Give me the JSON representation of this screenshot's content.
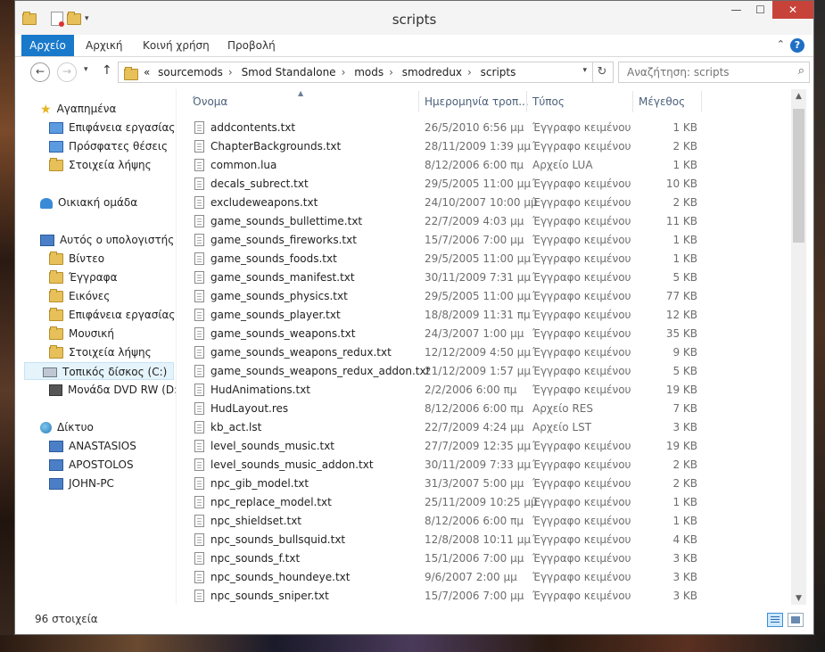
{
  "window": {
    "title": "scripts"
  },
  "window_buttons": {
    "minimize": "—",
    "maximize": "☐",
    "close": "✕"
  },
  "ribbon": {
    "tabs": [
      "Αρχείο",
      "Αρχική",
      "Κοινή χρήση",
      "Προβολή"
    ],
    "help": "?",
    "collapse": "⌃"
  },
  "nav": {
    "back": "←",
    "forward": "→",
    "recent": "▾",
    "up": "↑"
  },
  "address": {
    "overflow": "«",
    "crumbs": [
      "sourcemods",
      "Smod Standalone",
      "mods",
      "smodredux",
      "scripts"
    ],
    "dropdown": "▾",
    "refresh": "↻"
  },
  "search": {
    "placeholder": "Αναζήτηση: scripts",
    "icon": "⌕"
  },
  "sidebar": {
    "favorites": {
      "label": "Αγαπημένα",
      "items": [
        "Επιφάνεια εργασίας",
        "Πρόσφατες θέσεις",
        "Στοιχεία λήψης"
      ]
    },
    "homegroup": {
      "label": "Οικιακή ομάδα"
    },
    "computer": {
      "label": "Αυτός ο υπολογιστής",
      "items": [
        "Βίντεο",
        "Έγγραφα",
        "Εικόνες",
        "Επιφάνεια εργασίας",
        "Μουσική",
        "Στοιχεία λήψης",
        "Τοπικός δίσκος (C:)",
        "Μονάδα DVD RW (D:)"
      ]
    },
    "network": {
      "label": "Δίκτυο",
      "items": [
        "ANASTASIOS",
        "APOSTOLOS",
        "JOHN-PC"
      ]
    }
  },
  "columns": {
    "name": "Όνομα",
    "date": "Ημερομηνία τροπ...",
    "type": "Τύπος",
    "size": "Μέγεθος",
    "sort": "▲"
  },
  "files": [
    {
      "name": "addcontents.txt",
      "date": "26/5/2010 6:56 μμ",
      "type": "Έγγραφο κειμένου",
      "size": "1 KB"
    },
    {
      "name": "ChapterBackgrounds.txt",
      "date": "28/11/2009 1:39 μμ",
      "type": "Έγγραφο κειμένου",
      "size": "2 KB"
    },
    {
      "name": "common.lua",
      "date": "8/12/2006 6:00 πμ",
      "type": "Αρχείο LUA",
      "size": "1 KB"
    },
    {
      "name": "decals_subrect.txt",
      "date": "29/5/2005 11:00 μμ",
      "type": "Έγγραφο κειμένου",
      "size": "10 KB"
    },
    {
      "name": "excludeweapons.txt",
      "date": "24/10/2007 10:00 μμ",
      "type": "Έγγραφο κειμένου",
      "size": "2 KB"
    },
    {
      "name": "game_sounds_bullettime.txt",
      "date": "22/7/2009 4:03 μμ",
      "type": "Έγγραφο κειμένου",
      "size": "11 KB"
    },
    {
      "name": "game_sounds_fireworks.txt",
      "date": "15/7/2006 7:00 μμ",
      "type": "Έγγραφο κειμένου",
      "size": "1 KB"
    },
    {
      "name": "game_sounds_foods.txt",
      "date": "29/5/2005 11:00 μμ",
      "type": "Έγγραφο κειμένου",
      "size": "1 KB"
    },
    {
      "name": "game_sounds_manifest.txt",
      "date": "30/11/2009 7:31 μμ",
      "type": "Έγγραφο κειμένου",
      "size": "5 KB"
    },
    {
      "name": "game_sounds_physics.txt",
      "date": "29/5/2005 11:00 μμ",
      "type": "Έγγραφο κειμένου",
      "size": "77 KB"
    },
    {
      "name": "game_sounds_player.txt",
      "date": "18/8/2009 11:31 πμ",
      "type": "Έγγραφο κειμένου",
      "size": "12 KB"
    },
    {
      "name": "game_sounds_weapons.txt",
      "date": "24/3/2007 1:00 μμ",
      "type": "Έγγραφο κειμένου",
      "size": "35 KB"
    },
    {
      "name": "game_sounds_weapons_redux.txt",
      "date": "12/12/2009 4:50 μμ",
      "type": "Έγγραφο κειμένου",
      "size": "9 KB"
    },
    {
      "name": "game_sounds_weapons_redux_addon.txt",
      "date": "21/12/2009 1:57 μμ",
      "type": "Έγγραφο κειμένου",
      "size": "5 KB"
    },
    {
      "name": "HudAnimations.txt",
      "date": "2/2/2006 6:00 πμ",
      "type": "Έγγραφο κειμένου",
      "size": "19 KB"
    },
    {
      "name": "HudLayout.res",
      "date": "8/12/2006 6:00 πμ",
      "type": "Αρχείο RES",
      "size": "7 KB"
    },
    {
      "name": "kb_act.lst",
      "date": "22/7/2009 4:24 μμ",
      "type": "Αρχείο LST",
      "size": "3 KB"
    },
    {
      "name": "level_sounds_music.txt",
      "date": "27/7/2009 12:35 μμ",
      "type": "Έγγραφο κειμένου",
      "size": "19 KB"
    },
    {
      "name": "level_sounds_music_addon.txt",
      "date": "30/11/2009 7:33 μμ",
      "type": "Έγγραφο κειμένου",
      "size": "2 KB"
    },
    {
      "name": "npc_gib_model.txt",
      "date": "31/3/2007 5:00 μμ",
      "type": "Έγγραφο κειμένου",
      "size": "2 KB"
    },
    {
      "name": "npc_replace_model.txt",
      "date": "25/11/2009 10:25 μμ",
      "type": "Έγγραφο κειμένου",
      "size": "1 KB"
    },
    {
      "name": "npc_shieldset.txt",
      "date": "8/12/2006 6:00 πμ",
      "type": "Έγγραφο κειμένου",
      "size": "1 KB"
    },
    {
      "name": "npc_sounds_bullsquid.txt",
      "date": "12/8/2008 10:11 μμ",
      "type": "Έγγραφο κειμένου",
      "size": "4 KB"
    },
    {
      "name": "npc_sounds_f.txt",
      "date": "15/1/2006 7:00 μμ",
      "type": "Έγγραφο κειμένου",
      "size": "3 KB"
    },
    {
      "name": "npc_sounds_houndeye.txt",
      "date": "9/6/2007 2:00 μμ",
      "type": "Έγγραφο κειμένου",
      "size": "3 KB"
    },
    {
      "name": "npc_sounds_sniper.txt",
      "date": "15/7/2006 7:00 μμ",
      "type": "Έγγραφο κειμένου",
      "size": "3 KB"
    }
  ],
  "status": {
    "count": "96 στοιχεία"
  },
  "scrollbar": {
    "up": "▲",
    "down": "▼"
  }
}
